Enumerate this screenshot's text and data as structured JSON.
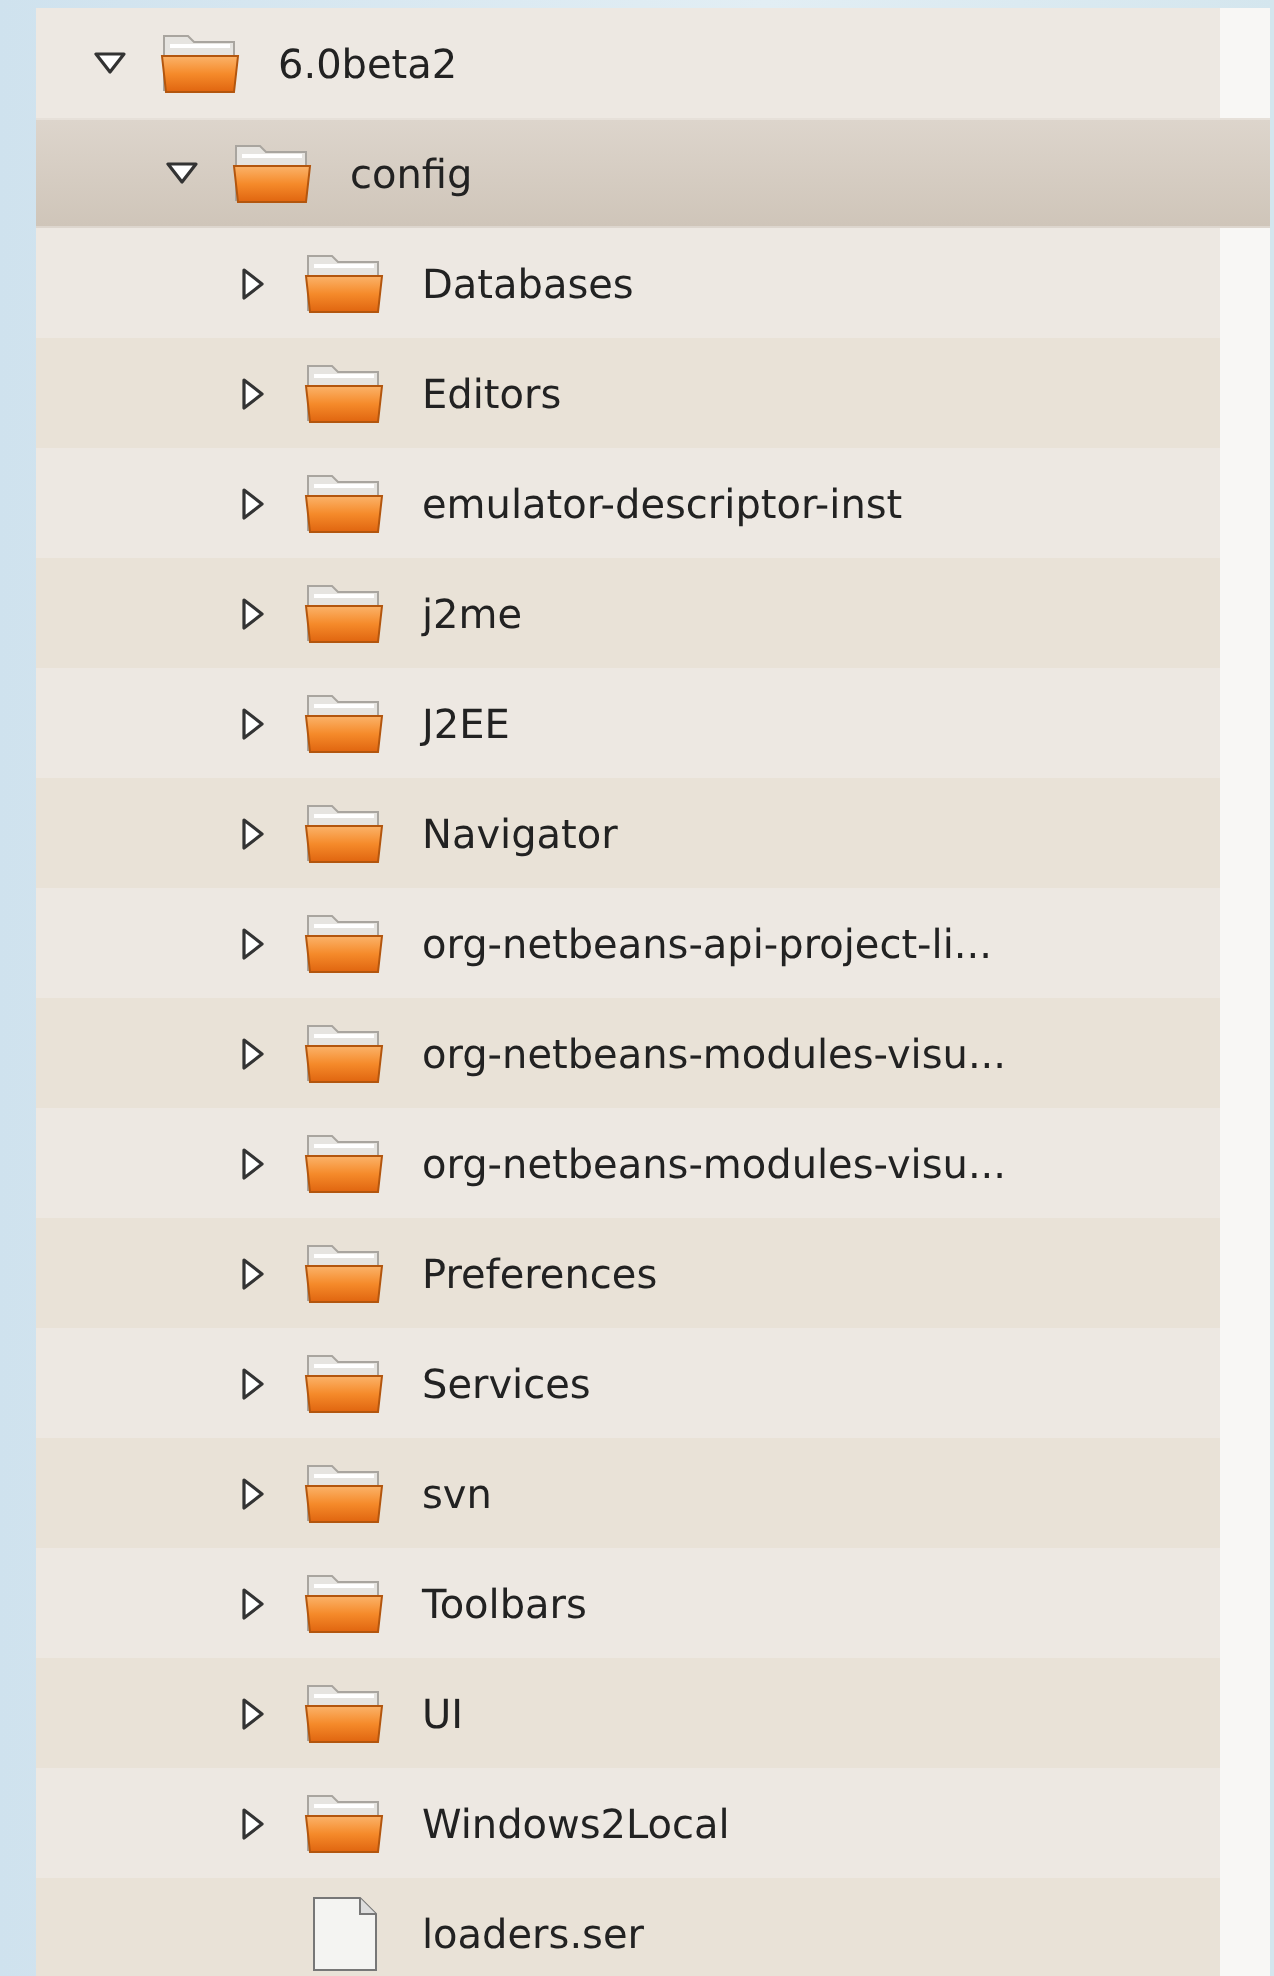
{
  "tree": {
    "items": [
      {
        "kind": "folder",
        "name": "6.0beta2",
        "expanded": true,
        "selected": false,
        "children": [
          {
            "kind": "folder",
            "name": "config",
            "expanded": true,
            "selected": true,
            "children": [
              {
                "kind": "folder",
                "name": "Databases",
                "expanded": false,
                "selected": false
              },
              {
                "kind": "folder",
                "name": "Editors",
                "expanded": false,
                "selected": false
              },
              {
                "kind": "folder",
                "name": "emulator-descriptor-inst",
                "expanded": false,
                "selected": false
              },
              {
                "kind": "folder",
                "name": "j2me",
                "expanded": false,
                "selected": false
              },
              {
                "kind": "folder",
                "name": "J2EE",
                "expanded": false,
                "selected": false
              },
              {
                "kind": "folder",
                "name": "Navigator",
                "expanded": false,
                "selected": false
              },
              {
                "kind": "folder",
                "name": "org-netbeans-api-project-li...",
                "expanded": false,
                "selected": false
              },
              {
                "kind": "folder",
                "name": "org-netbeans-modules-visu...",
                "expanded": false,
                "selected": false
              },
              {
                "kind": "folder",
                "name": "org-netbeans-modules-visu...",
                "expanded": false,
                "selected": false
              },
              {
                "kind": "folder",
                "name": "Preferences",
                "expanded": false,
                "selected": false
              },
              {
                "kind": "folder",
                "name": "Services",
                "expanded": false,
                "selected": false
              },
              {
                "kind": "folder",
                "name": "svn",
                "expanded": false,
                "selected": false
              },
              {
                "kind": "folder",
                "name": "Toolbars",
                "expanded": false,
                "selected": false
              },
              {
                "kind": "folder",
                "name": "UI",
                "expanded": false,
                "selected": false
              },
              {
                "kind": "folder",
                "name": "Windows2Local",
                "expanded": false,
                "selected": false
              },
              {
                "kind": "file",
                "name": "loaders.ser",
                "selected": false
              }
            ]
          }
        ]
      }
    ]
  }
}
